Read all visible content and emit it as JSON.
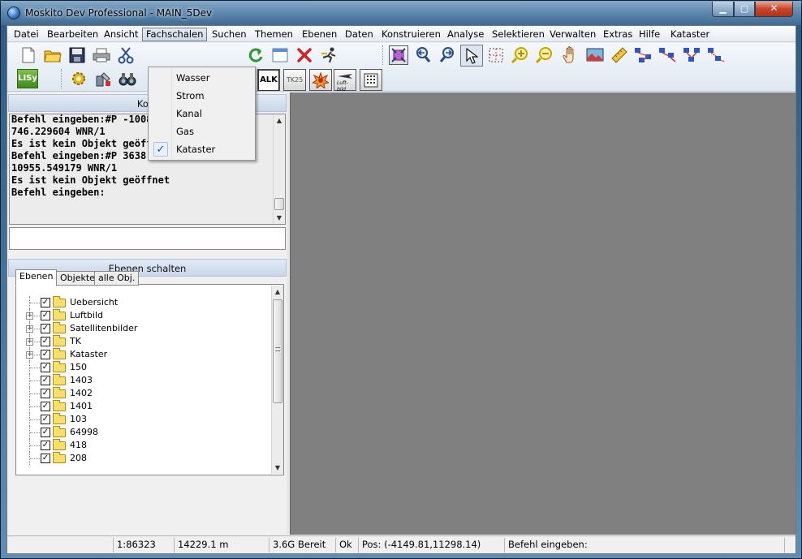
{
  "window": {
    "title": "Moskito Dev Professional - MAIN_5Dev"
  },
  "menu": {
    "items": [
      "Datei",
      "Bearbeiten",
      "Ansicht",
      "Fachschalen",
      "Suchen",
      "Themen",
      "Ebenen",
      "Daten",
      "Konstruieren",
      "Analyse",
      "Selektieren",
      "Verwalten",
      "Extras",
      "Hilfe",
      "Kataster"
    ],
    "active": "Fachschalen"
  },
  "fachschalen_menu": {
    "items": [
      {
        "label": "Wasser",
        "checked": false
      },
      {
        "label": "Strom",
        "checked": false
      },
      {
        "label": "Kanal",
        "checked": false
      },
      {
        "label": "Gas",
        "checked": false
      },
      {
        "label": "Kataster",
        "checked": true
      }
    ],
    "check_glyph": "✓"
  },
  "toolbar": {
    "row1_icons": [
      "new-document-icon",
      "open-folder-icon",
      "save-disk-icon",
      "print-icon",
      "cut-scissors-icon",
      "refresh-icon",
      "window-icon",
      "delete-x-icon",
      "runner-icon",
      "zoom-extent-icon",
      "zoom-back-icon",
      "zoom-forward-icon",
      "select-arrow-icon",
      "select-grid-icon",
      "zoom-in-magnifier-icon",
      "zoom-out-magnifier-icon",
      "pan-hand-icon",
      "map-picture-icon",
      "ruler-icon",
      "network-blue-icon",
      "network-red-icon",
      "network-connect-icon",
      "network-edit-icon"
    ],
    "row2_icons": [
      "lisy-icon",
      "gear-gold-icon",
      "tools-icon",
      "binoculars-icon",
      "alk-button",
      "tk25-button",
      "burst-icon",
      "luftbild-button",
      "grid-dots-icon"
    ],
    "alk_label": "ALK",
    "tk25_label": "TK25",
    "lisy_label": "LISy",
    "luftbild_label": "Luft-bild"
  },
  "command_panel": {
    "header": "Kom",
    "lines": [
      "Befehl eingeben:#P -1008.373909",
      "746.229604 WNR/1",
      "Es ist kein Objekt geöffnet",
      "Befehl eingeben:#P 3638.507418",
      "10955.549179 WNR/1",
      "Es ist kein Objekt geöffnet",
      "Befehl eingeben:"
    ]
  },
  "layers_panel": {
    "header": "Ebenen schalten",
    "tabs": [
      "Ebenen",
      "Objekte",
      "alle Obj."
    ],
    "active_tab": "Ebenen",
    "tree": [
      {
        "label": "Uebersicht",
        "expandable": false,
        "checked": true
      },
      {
        "label": "Luftbild",
        "expandable": true,
        "checked": true
      },
      {
        "label": "Satellitenbilder",
        "expandable": true,
        "checked": true
      },
      {
        "label": "TK",
        "expandable": true,
        "checked": true
      },
      {
        "label": "Kataster",
        "expandable": true,
        "checked": true
      },
      {
        "label": "150",
        "expandable": false,
        "checked": true
      },
      {
        "label": "1403",
        "expandable": false,
        "checked": true
      },
      {
        "label": "1402",
        "expandable": false,
        "checked": true
      },
      {
        "label": "1401",
        "expandable": false,
        "checked": true
      },
      {
        "label": "103",
        "expandable": false,
        "checked": true
      },
      {
        "label": "64998",
        "expandable": false,
        "checked": true
      },
      {
        "label": "418",
        "expandable": false,
        "checked": true
      },
      {
        "label": "208",
        "expandable": false,
        "checked": true
      }
    ]
  },
  "status": {
    "scale": "1:86323",
    "distance": "14229.1 m",
    "memory": "3.6G",
    "state": "Bereit",
    "ok": "Ok",
    "position": "Pos: (-4149.81,11298.14)",
    "prompt": "Befehl eingeben:"
  },
  "colors": {
    "map_background": "#808080",
    "menu_active": "#cfd9e6"
  }
}
